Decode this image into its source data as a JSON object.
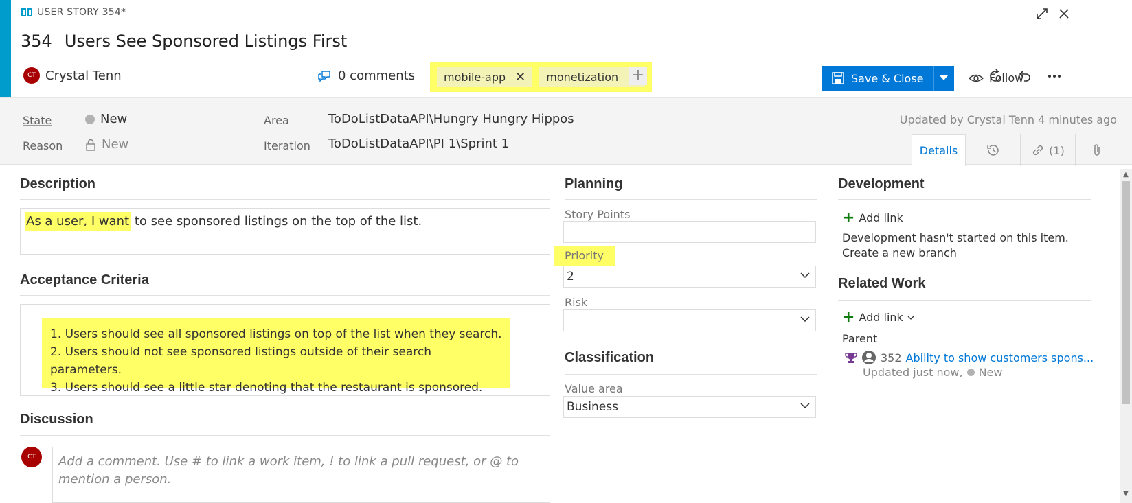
{
  "window": {
    "type_label": "USER STORY 354*",
    "expand_icon": "expand-icon",
    "close_icon": "close-icon"
  },
  "work_item": {
    "id": "354",
    "title": "Users See Sponsored Listings First",
    "assigned_to": "Crystal Tenn",
    "avatar_initials": "CT",
    "comments_label": "0 comments",
    "tags": [
      "mobile-app",
      "monetization"
    ]
  },
  "toolbar": {
    "save_label": "Save & Close",
    "follow_label": "Follow"
  },
  "meta": {
    "state_label": "State",
    "state_value": "New",
    "reason_label": "Reason",
    "reason_value": "New",
    "area_label": "Area",
    "area_value": "ToDoListDataAPI\\Hungry Hungry Hippos",
    "iteration_label": "Iteration",
    "iteration_value": "ToDoListDataAPI\\PI 1\\Sprint 1",
    "updated_text": "Updated by Crystal Tenn 4 minutes ago"
  },
  "tabs": {
    "details_label": "Details",
    "links_label": "(1)"
  },
  "description": {
    "heading": "Description",
    "highlighted": "As a user, I want",
    "rest": " to see sponsored listings on the top of the list."
  },
  "acceptance": {
    "heading": "Acceptance Criteria",
    "items": [
      "1. Users should see all sponsored listings on top of the list when they search.",
      "2. Users should not see sponsored listings outside of their search parameters.",
      "3. Users should see a little star denoting that the restaurant is sponsored."
    ]
  },
  "discussion": {
    "heading": "Discussion",
    "placeholder": "Add a comment. Use # to link a work item, ! to link a pull request, or @ to mention a person."
  },
  "planning": {
    "heading": "Planning",
    "story_points_label": "Story Points",
    "story_points_value": "",
    "priority_label": "Priority",
    "priority_value": "2",
    "risk_label": "Risk",
    "risk_value": ""
  },
  "classification": {
    "heading": "Classification",
    "value_area_label": "Value area",
    "value_area_value": "Business"
  },
  "development": {
    "heading": "Development",
    "add_link_label": "Add link",
    "status_text": "Development hasn't started on this item.",
    "create_branch_label": "Create a new branch"
  },
  "related_work": {
    "heading": "Related Work",
    "add_link_label": "Add link",
    "parent_label": "Parent",
    "parent_id": "352",
    "parent_title": "Ability to show customers spons...",
    "parent_updated": "Updated just now,",
    "parent_state": "New"
  },
  "colors": {
    "accent": "#009ccc",
    "primary_button": "#0078d7",
    "highlight": "#ffff66",
    "avatar": "#a80000",
    "link": "#0078d7"
  }
}
